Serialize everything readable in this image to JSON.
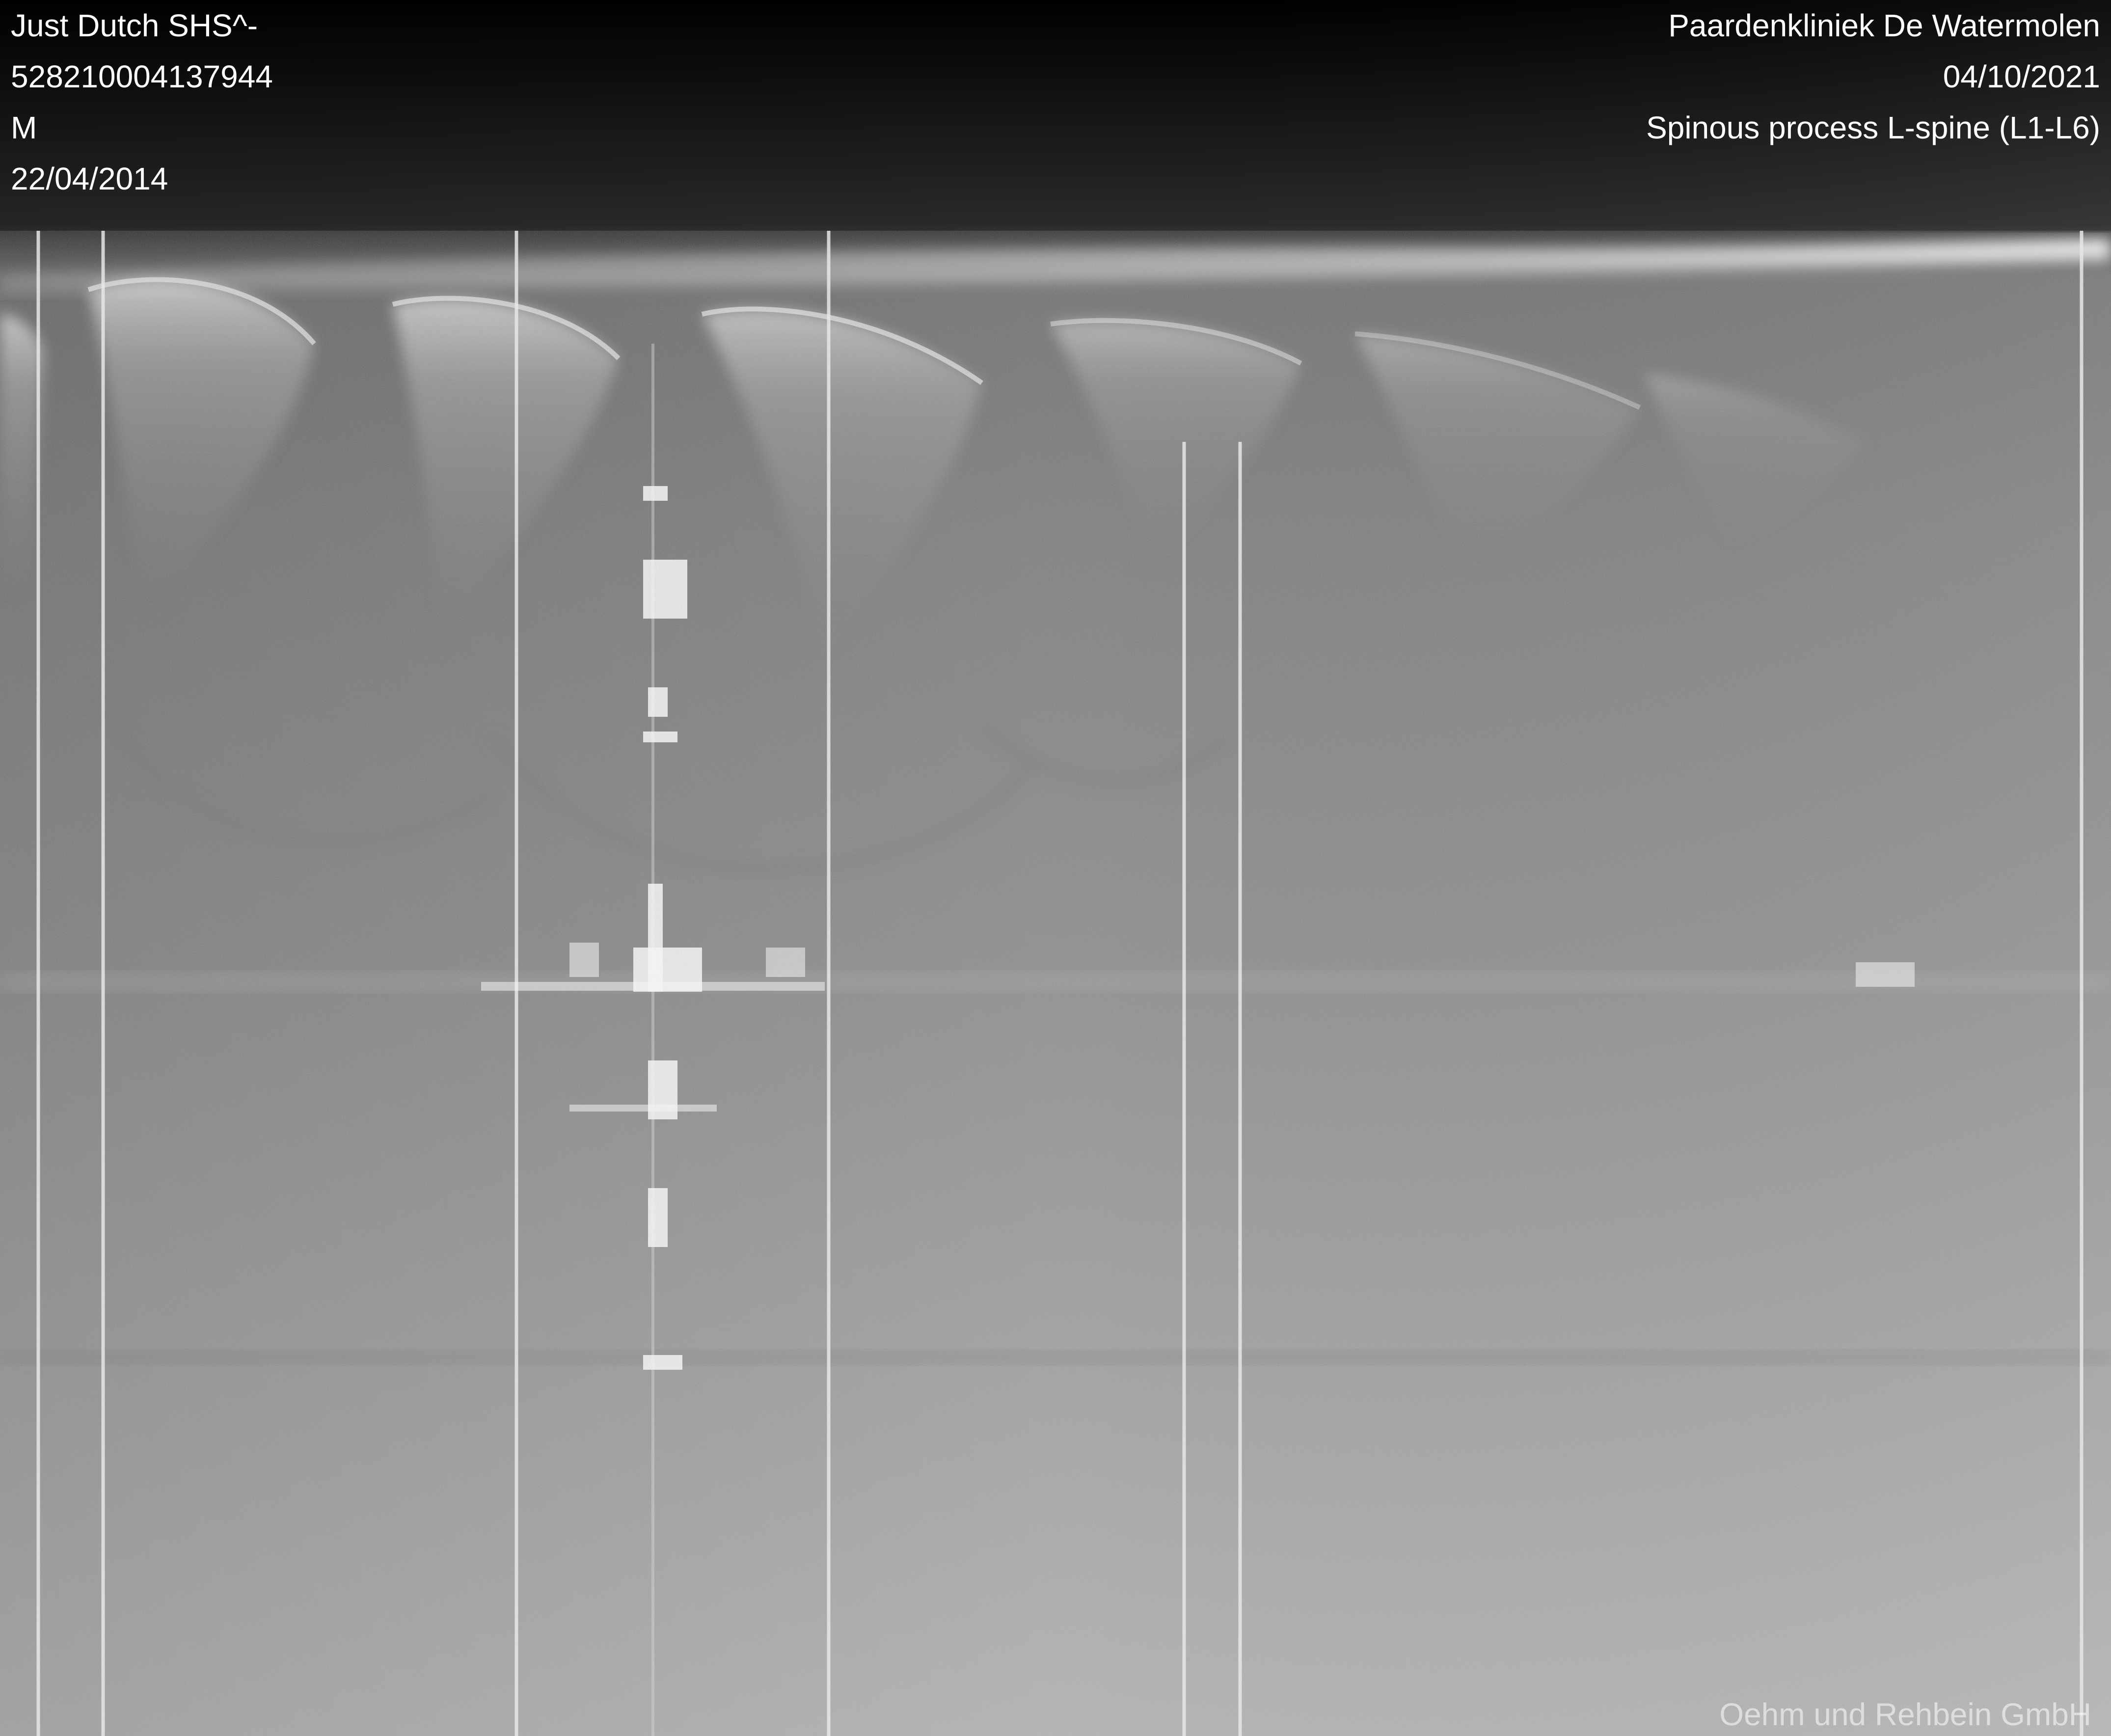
{
  "patient": {
    "name": "Just Dutch SHS^-",
    "id": "528210004137944",
    "sex": "M",
    "birth_date": "22/04/2014"
  },
  "study": {
    "institution": "Paardenkliniek De Watermolen",
    "date": "04/10/2021",
    "description": "Spinous process L-spine (L1-L6)"
  },
  "watermark": "Oehm und Rehbein GmbH",
  "image": {
    "modality_appearance": "grayscale radiograph",
    "colors": {
      "background_top": "#000000",
      "tissue_gray": "#8a8a8a",
      "bone_light": "#d6d6d6",
      "text": "#ffffff"
    }
  }
}
